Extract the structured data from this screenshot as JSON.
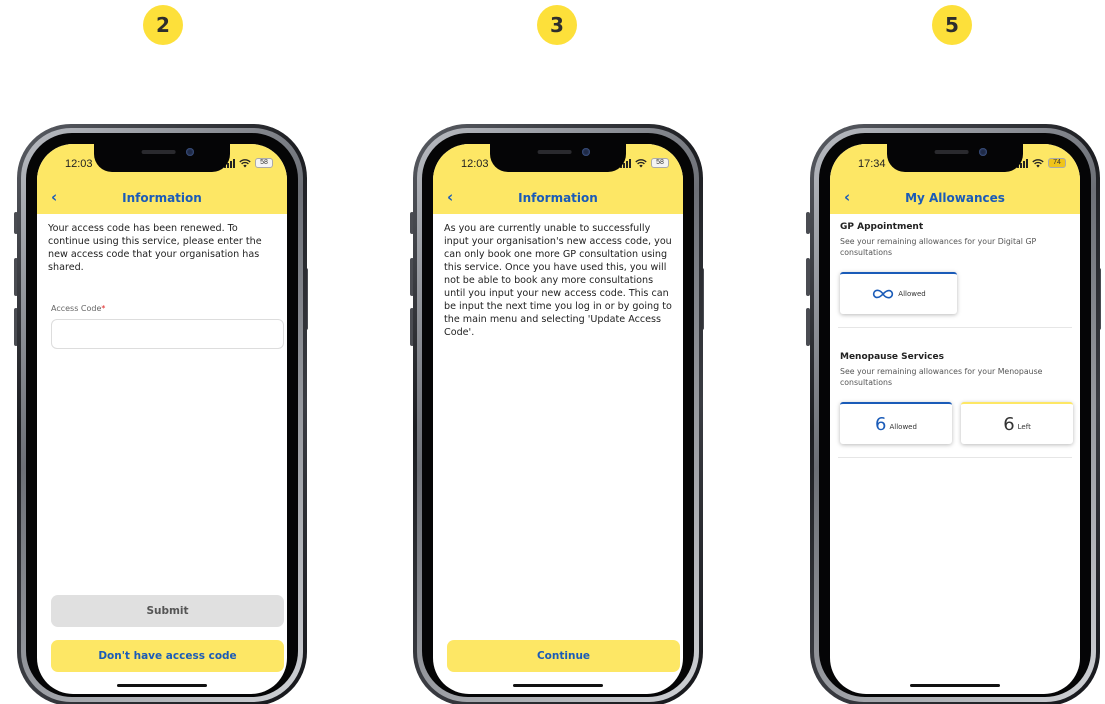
{
  "steps": [
    "2",
    "3",
    "5"
  ],
  "phone1": {
    "time": "12:03",
    "battery": "58",
    "back_icon": "‹",
    "title": "Information",
    "message": "Your access code has been renewed. To continue using this service, please enter the new access code that your organisation has shared.",
    "field_label": "Access Code",
    "required_mark": "*",
    "field_value": "",
    "submit_label": "Submit",
    "no_code_label": "Don't have access code"
  },
  "phone2": {
    "time": "12:03",
    "battery": "58",
    "back_icon": "‹",
    "title": "Information",
    "message": "As you are currently unable to successfully input your organisation's new access code, you can only book one more GP consultation using this service. Once you have used this, you will not be able to book any more consultations until you input your new access code. This can be input the next time you log in or by going to the main menu and selecting 'Update Access Code'.",
    "continue_label": "Continue"
  },
  "phone3": {
    "time": "17:34",
    "battery": "74",
    "back_icon": "‹",
    "title": "My Allowances",
    "gp": {
      "title": "GP Appointment",
      "desc": "See your remaining allowances for your Digital GP consultations",
      "allowed_label": "Allowed",
      "icon": "infinity-icon"
    },
    "menopause": {
      "title": "Menopause Services",
      "desc": "See your remaining allowances for your Menopause consultations",
      "allowed_value": "6",
      "allowed_label": "Allowed",
      "left_value": "6",
      "left_label": "Left"
    }
  },
  "colors": {
    "accent_yellow": "#fde765",
    "badge_yellow": "#fde03a",
    "brand_blue": "#1a5bb8"
  }
}
